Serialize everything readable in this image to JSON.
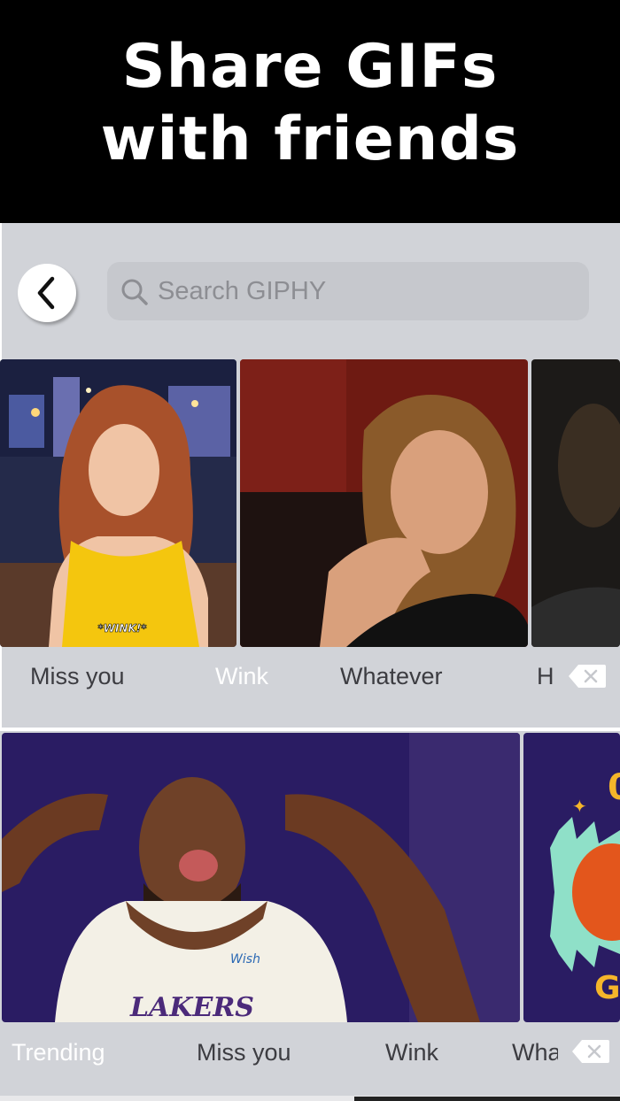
{
  "banner": {
    "line1": "Share GIFs",
    "line2": "with friends"
  },
  "search": {
    "placeholder": "Search GIPHY"
  },
  "icons": {
    "back": "chevron-left-icon",
    "search": "magnifier-icon",
    "delete": "backspace-icon"
  },
  "keyboard1": {
    "gif_captions": [
      "*WINK!*"
    ],
    "tags": [
      "Miss you",
      "Wink",
      "Whatever",
      "H"
    ],
    "active_tag": "Wink"
  },
  "keyboard2": {
    "tags": [
      "Trending",
      "Miss you",
      "Wink",
      "Wha"
    ],
    "active_tag": "Trending",
    "jersey_text": "LAKERS",
    "sponsor_text": "Wish"
  },
  "colors": {
    "banner_bg": "#000000",
    "keyboard_bg": "#d1d3d8",
    "search_bg": "#c6c8cd",
    "tag_text": "#3c3c41",
    "active_tag_text": "#ffffff"
  }
}
